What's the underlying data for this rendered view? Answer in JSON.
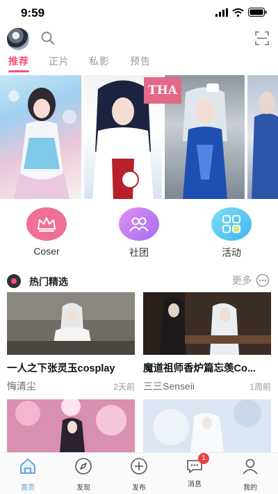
{
  "status_bar": {
    "time": "9:59"
  },
  "tabs": [
    {
      "label": "推荐",
      "active": true
    },
    {
      "label": "正片",
      "active": false
    },
    {
      "label": "私影",
      "active": false
    },
    {
      "label": "预告",
      "active": false
    }
  ],
  "banner": {
    "badge_text": "THA"
  },
  "categories": [
    {
      "label": "Coser",
      "color": "#f06f95",
      "icon": "crown-icon"
    },
    {
      "label": "社团",
      "color": "#c87ef3",
      "icon": "group-icon"
    },
    {
      "label": "活动",
      "color": "#4fc3f7",
      "icon": "grid-icon"
    }
  ],
  "section": {
    "title": "热门精选",
    "more_label": "更多"
  },
  "cards": [
    {
      "title": "一人之下张灵玉cosplay",
      "author": "悔清尘",
      "time": "2天前"
    },
    {
      "title": "魔道祖师香炉篇忘羡Co...",
      "author": "三三Senseii",
      "time": "1周前"
    },
    {
      "title": "",
      "author": "",
      "time": ""
    },
    {
      "title": "",
      "author": "",
      "time": ""
    }
  ],
  "tabbar": [
    {
      "label": "首页",
      "icon": "home-icon",
      "active": true
    },
    {
      "label": "发现",
      "icon": "compass-icon",
      "active": false
    },
    {
      "label": "发布",
      "icon": "plus-icon",
      "active": false
    },
    {
      "label": "消息",
      "icon": "message-icon",
      "active": false,
      "badge": "1"
    },
    {
      "label": "我的",
      "icon": "user-icon",
      "active": false
    }
  ],
  "colors": {
    "accent": "#f0557a",
    "tab_active": "#5b9bd5",
    "badge": "#e8433f"
  }
}
